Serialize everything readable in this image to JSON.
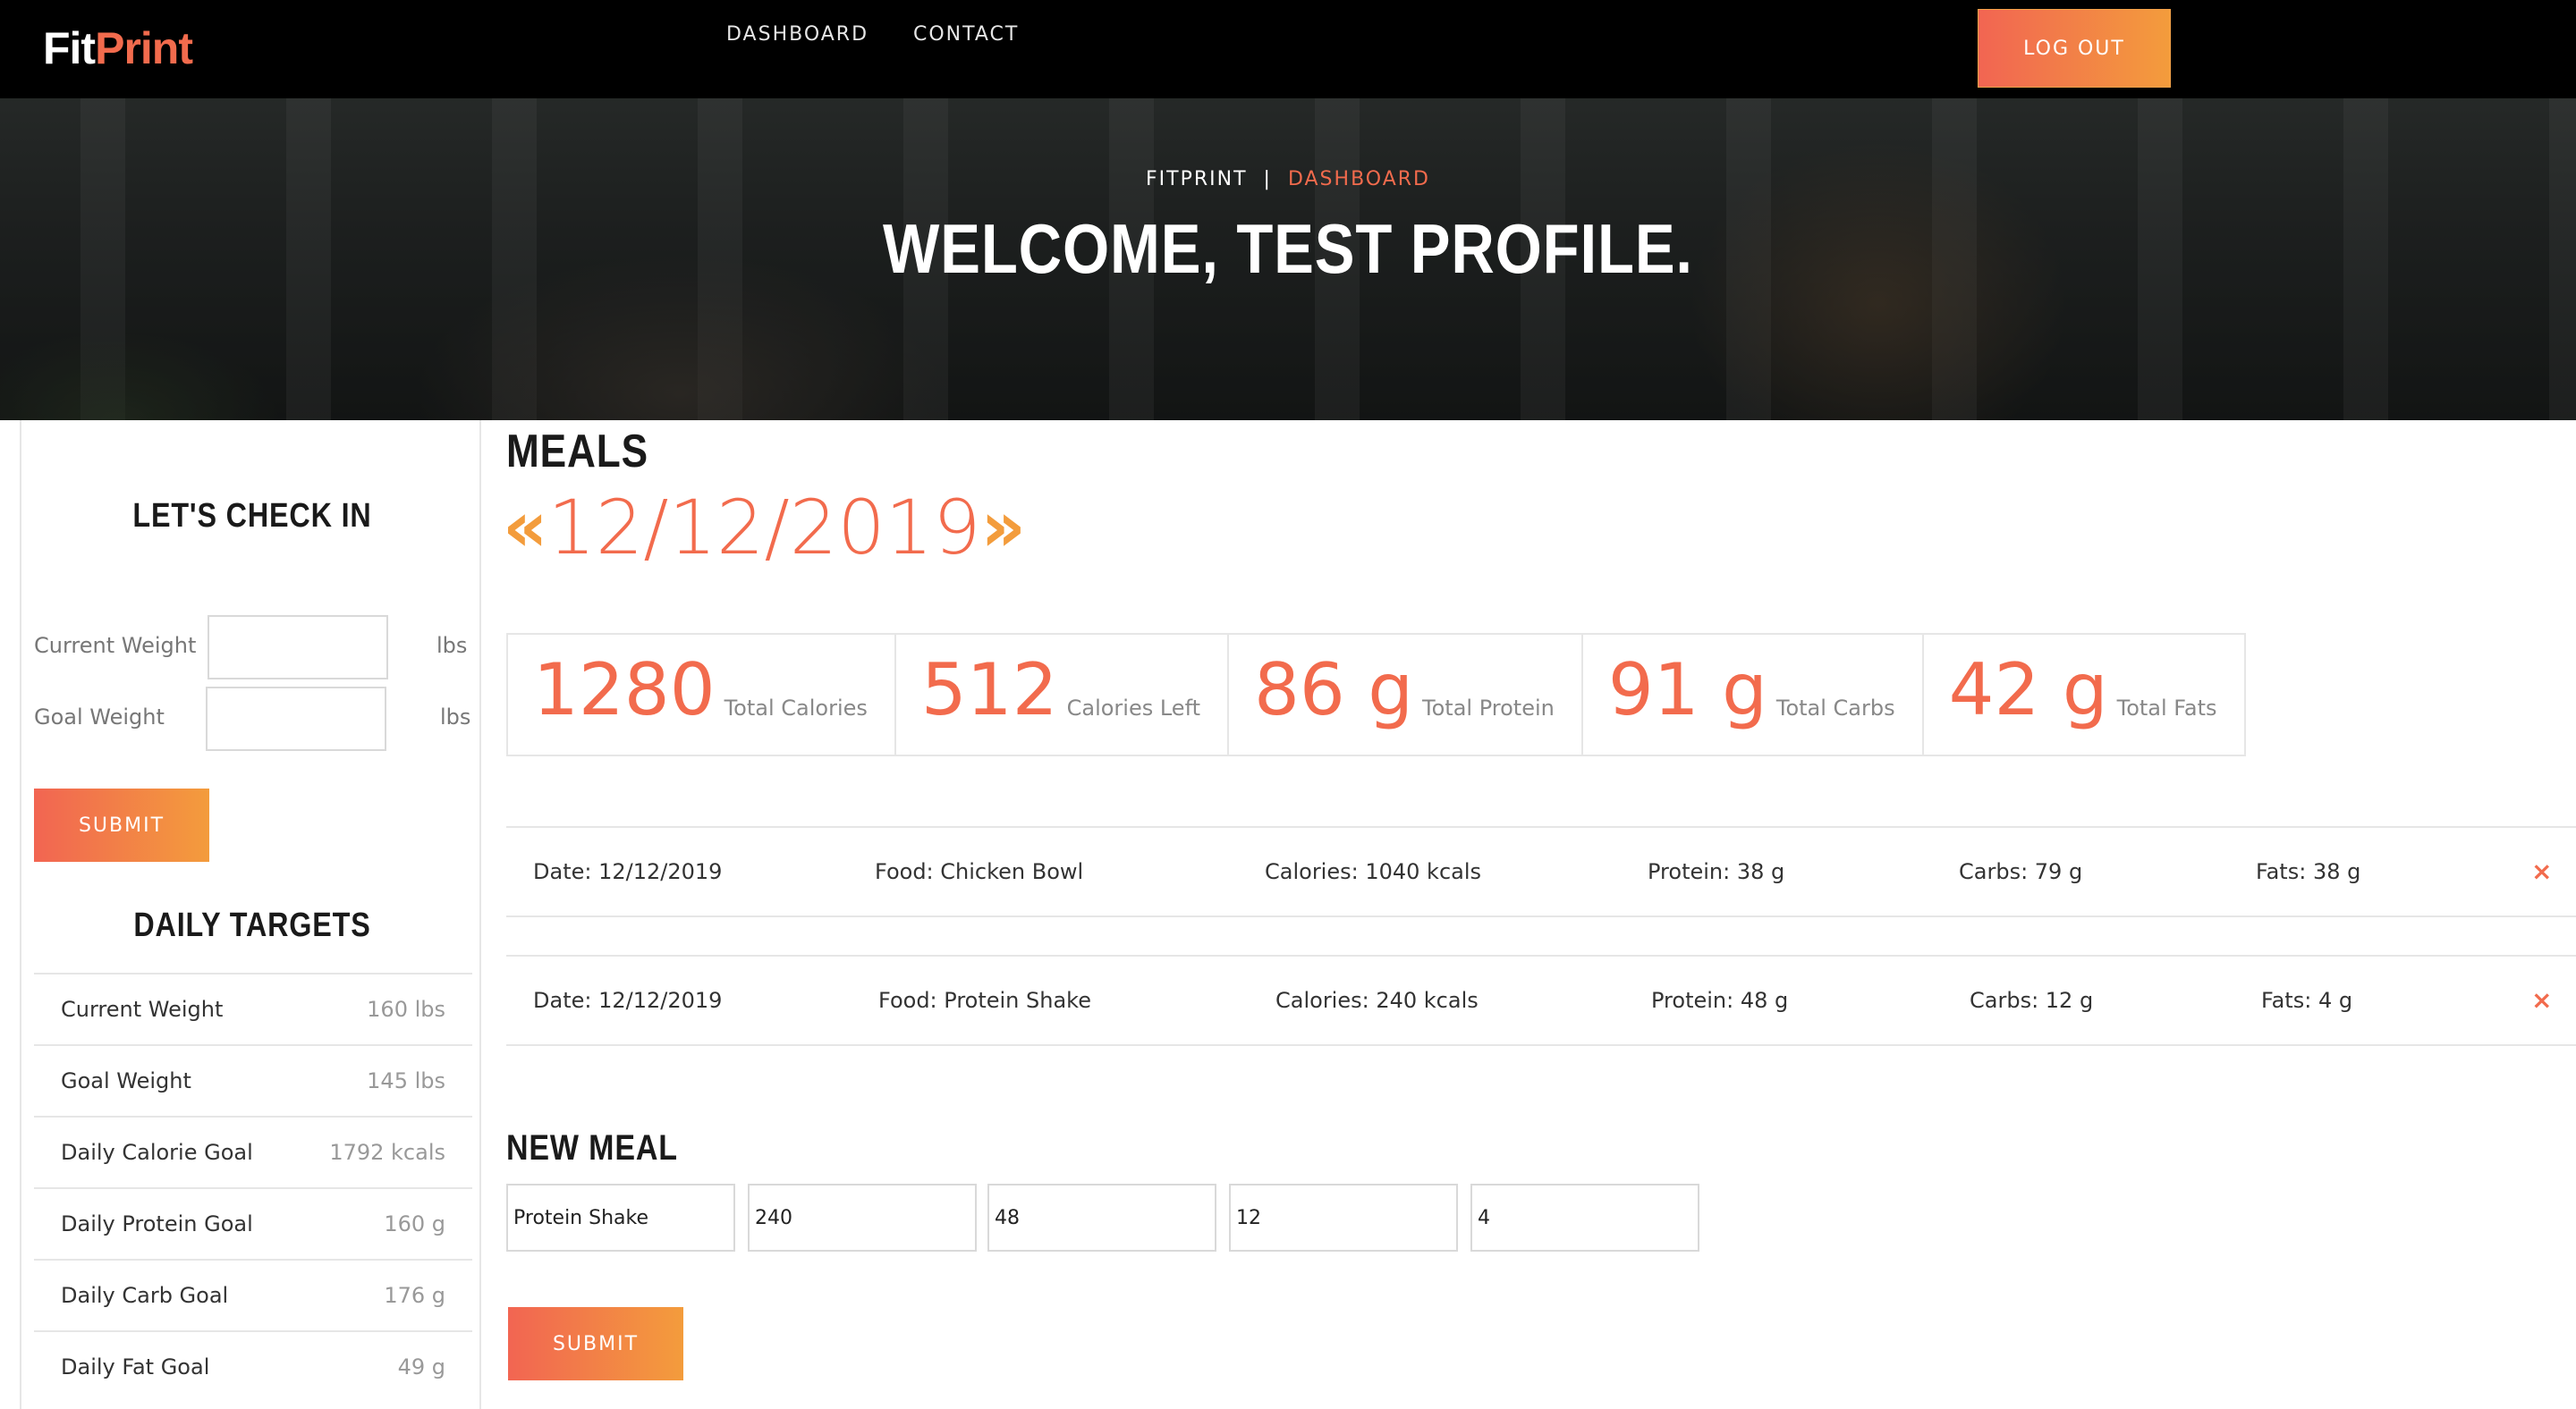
{
  "app": {
    "logo_fit": "Fit",
    "logo_print": "Print",
    "nav": {
      "dashboard": "DASHBOARD",
      "contact": "CONTACT",
      "logout": "LOG OUT"
    }
  },
  "hero": {
    "breadcrumb_home": "FITPRINT",
    "breadcrumb_sep": "|",
    "breadcrumb_current": "DASHBOARD",
    "title": "WELCOME, TEST PROFILE."
  },
  "sidebar": {
    "checkin_title": "LET'S CHECK IN",
    "current_weight_label": "Current Weight",
    "current_weight_value": "",
    "current_weight_unit": "lbs",
    "goal_weight_label": "Goal Weight",
    "goal_weight_value": "",
    "goal_weight_unit": "lbs",
    "submit_label": "SUBMIT",
    "targets_title": "DAILY TARGETS",
    "targets": [
      {
        "name": "Current Weight",
        "value": "160 lbs"
      },
      {
        "name": "Goal Weight",
        "value": "145 lbs"
      },
      {
        "name": "Daily Calorie Goal",
        "value": "1792 kcals"
      },
      {
        "name": "Daily Protein Goal",
        "value": "160 g"
      },
      {
        "name": "Daily Carb Goal",
        "value": "176 g"
      },
      {
        "name": "Daily Fat Goal",
        "value": "49 g"
      }
    ]
  },
  "meals": {
    "title": "MEALS",
    "prev_arrow": "«",
    "date": "12/12/2019",
    "next_arrow": "»",
    "summary": [
      {
        "value": "1280",
        "label": "Total Calories"
      },
      {
        "value": "512",
        "label": "Calories Left"
      },
      {
        "value": "86 g",
        "label": "Total Protein"
      },
      {
        "value": "91 g",
        "label": "Total Carbs"
      },
      {
        "value": "42 g",
        "label": "Total Fats"
      }
    ],
    "entries": [
      {
        "date": "Date: 12/12/2019",
        "food": "Food: Chicken Bowl",
        "calories": "Calories: 1040 kcals",
        "protein": "Protein: 38 g",
        "carbs": "Carbs: 79 g",
        "fats": "Fats: 38 g",
        "delete": "×"
      },
      {
        "date": "Date: 12/12/2019",
        "food": "Food: Protein Shake",
        "calories": "Calories: 240 kcals",
        "protein": "Protein: 48 g",
        "carbs": "Carbs: 12 g",
        "fats": "Fats: 4 g",
        "delete": "×"
      }
    ]
  },
  "new_meal": {
    "title": "NEW MEAL",
    "food": "Protein Shake",
    "calories": "240",
    "protein": "48",
    "carbs": "12",
    "fats": "4",
    "submit_label": "SUBMIT"
  },
  "colors": {
    "accent": "#f26b4d",
    "accent_gradient_end": "#f39c3c",
    "nav_bg": "#000000"
  }
}
